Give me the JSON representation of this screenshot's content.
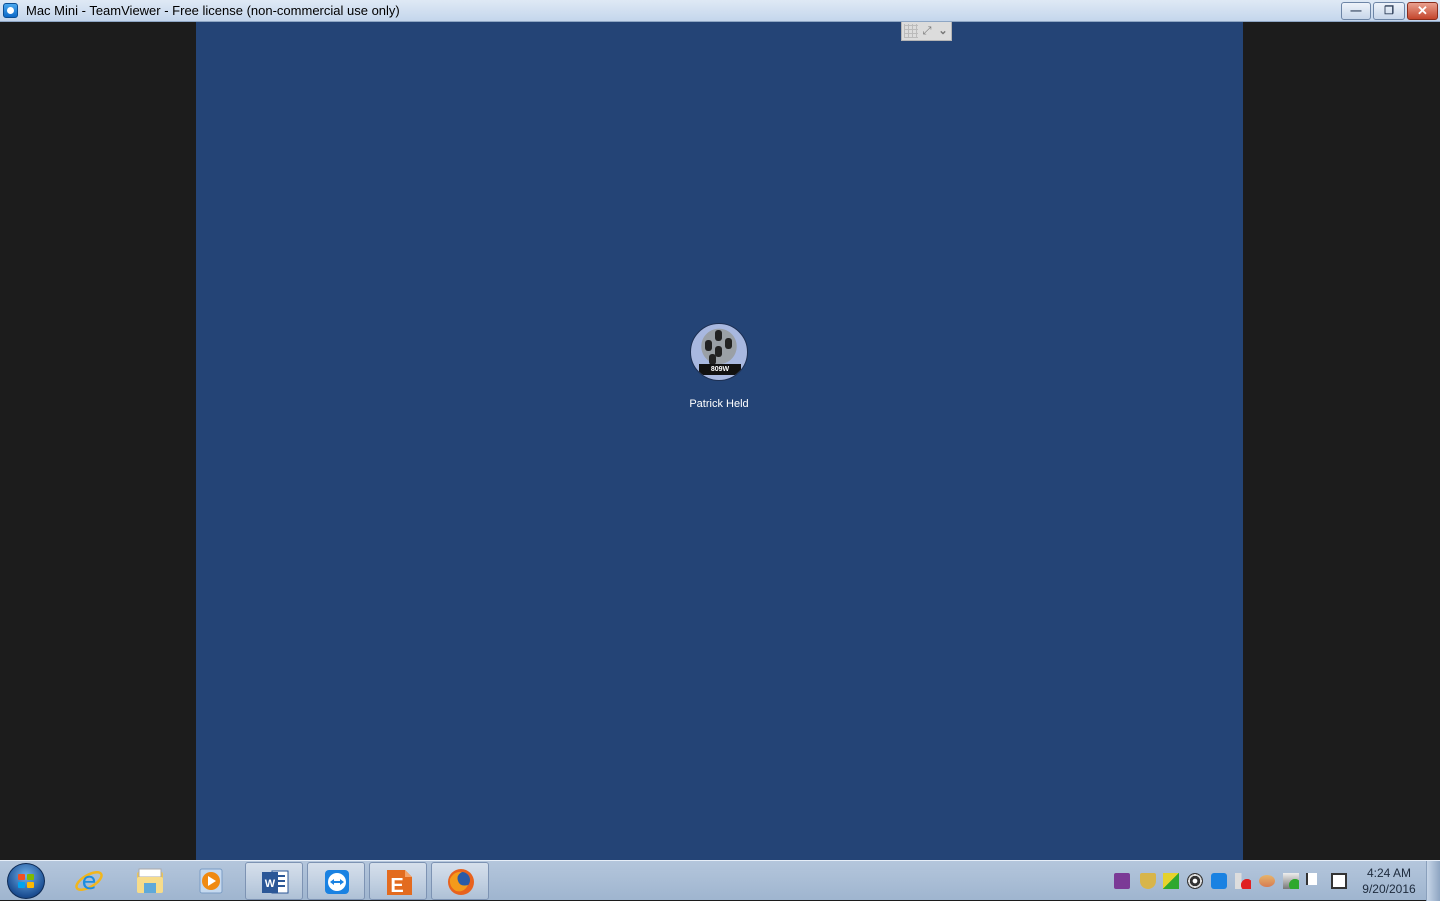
{
  "window": {
    "title": "Mac Mini - TeamViewer - Free license (non-commercial use only)",
    "app_icon": "teamviewer-icon",
    "buttons": {
      "minimize": "—",
      "restore": "❐",
      "close": "✕"
    }
  },
  "remote_toolbar": {
    "items": [
      {
        "name": "grid-icon",
        "glyph": ""
      },
      {
        "name": "fullscreen-icon",
        "glyph": "⤢"
      },
      {
        "name": "chevron-down-icon",
        "glyph": "⌄"
      }
    ]
  },
  "login_screen": {
    "user_name": "Patrick Held",
    "avatar_caption": "809W",
    "background_color": "#244476"
  },
  "taskbar": {
    "start_label": "Start",
    "apps": [
      {
        "name": "internet-explorer",
        "label": "Internet Explorer",
        "open": false
      },
      {
        "name": "file-explorer",
        "label": "Windows Explorer",
        "open": false
      },
      {
        "name": "media-player",
        "label": "Windows Media Player",
        "open": false
      },
      {
        "name": "word",
        "label": "Microsoft Word",
        "open": true
      },
      {
        "name": "teamviewer",
        "label": "TeamViewer",
        "open": true
      },
      {
        "name": "e-app",
        "label": "E",
        "open": true
      },
      {
        "name": "firefox",
        "label": "Firefox",
        "open": true
      }
    ],
    "tray": [
      "onenote-clip-icon",
      "security-shield-icon",
      "network-monitor-icon",
      "spiral-icon",
      "teamviewer-tray-icon",
      "volume-muted-icon",
      "cloud-icon",
      "printer-add-icon",
      "action-center-flag-icon",
      "network-icon"
    ],
    "clock": {
      "time": "4:24 AM",
      "date": "9/20/2016"
    }
  }
}
